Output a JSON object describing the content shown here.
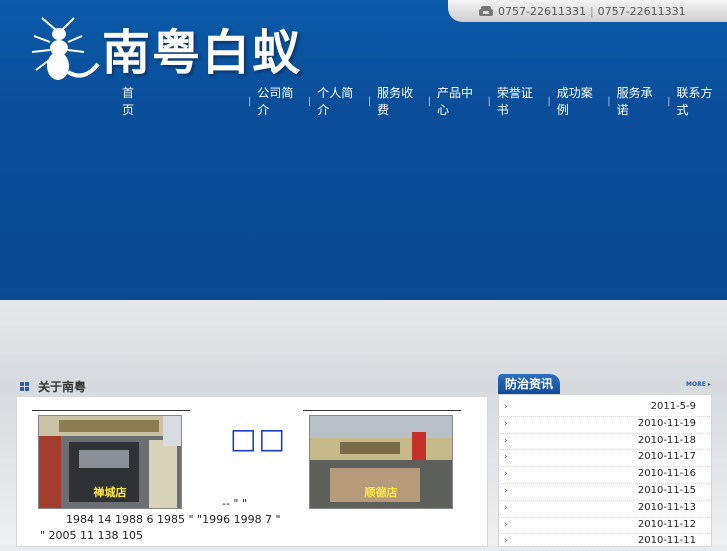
{
  "header": {
    "phone": [
      "0757-22611331",
      "0757-22611331"
    ],
    "brand": "南粤白蚁"
  },
  "nav": [
    {
      "label": "首　　页"
    },
    {
      "label": "公司简介"
    },
    {
      "label": "个人简介"
    },
    {
      "label": "服务收费"
    },
    {
      "label": "产品中心"
    },
    {
      "label": "荣誉证书"
    },
    {
      "label": "成功案例"
    },
    {
      "label": "服务承诺"
    },
    {
      "label": "联系方式"
    }
  ],
  "about": {
    "title": "关于南粤",
    "photos": [
      {
        "caption": "禅城店"
      },
      {
        "caption": "顺德店"
      }
    ],
    "middle_mark": "□□",
    "text_lines": [
      "--          \"  \"",
      "1984 14        1988 6          1985    \"    \"1996        1998 7      \"",
      "\" 2005 11        138      105"
    ]
  },
  "news": {
    "title": "防治资讯",
    "more": "MORE",
    "dates": [
      "2011-5-9",
      "2010-11-19",
      "2010-11-18",
      "2010-11-17",
      "2010-11-16",
      "2010-11-15",
      "2010-11-13",
      "2010-11-12",
      "2010-11-11"
    ]
  },
  "colors": {
    "header_blue": "#0b4a93",
    "accent_blue": "#1a3fc4",
    "caption_yellow": "#ffe74a"
  }
}
